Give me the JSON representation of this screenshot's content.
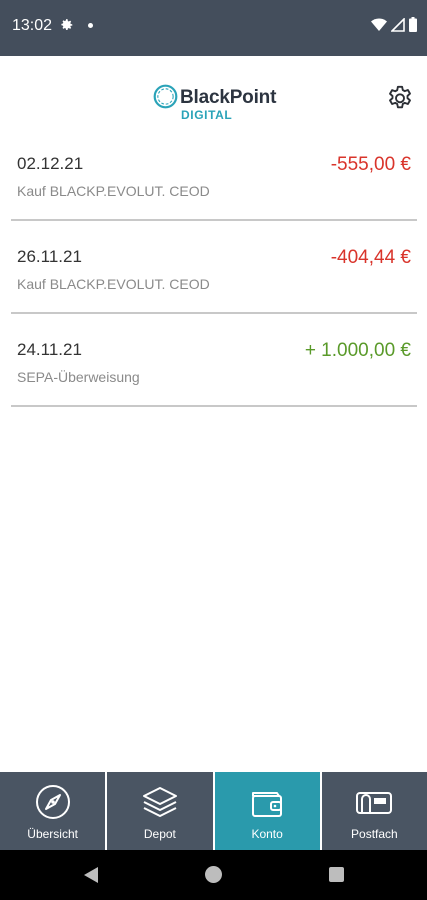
{
  "status_bar": {
    "time": "13:02",
    "icons": [
      "settings-icon",
      "notification-dot-icon",
      "wifi-icon",
      "signal-icon",
      "battery-icon"
    ]
  },
  "header": {
    "logo_name": "BlackPoint",
    "logo_sub": "DIGITAL",
    "settings_icon": "gear-icon"
  },
  "transactions": [
    {
      "date": "02.12.21",
      "description": "Kauf BLACKP.EVOLUT. CEOD",
      "amount": "-555,00 €",
      "type": "negative"
    },
    {
      "date": "26.11.21",
      "description": "Kauf BLACKP.EVOLUT. CEOD",
      "amount": "-404,44 €",
      "type": "negative"
    },
    {
      "date": "24.11.21",
      "description": "SEPA-Überweisung",
      "amount": "+ 1.000,00 €",
      "type": "positive"
    }
  ],
  "bottom_nav": {
    "items": [
      {
        "label": "Übersicht",
        "icon": "compass-icon",
        "active": false
      },
      {
        "label": "Depot",
        "icon": "layers-icon",
        "active": false
      },
      {
        "label": "Konto",
        "icon": "wallet-icon",
        "active": true
      },
      {
        "label": "Postfach",
        "icon": "mailbox-icon",
        "active": false
      }
    ]
  },
  "colors": {
    "status_bar": "#444e5c",
    "nav_bg": "#4a5563",
    "nav_active": "#2a9aac",
    "negative": "#d9342b",
    "positive": "#5a9a2a",
    "brand_accent": "#2aa3b8"
  }
}
